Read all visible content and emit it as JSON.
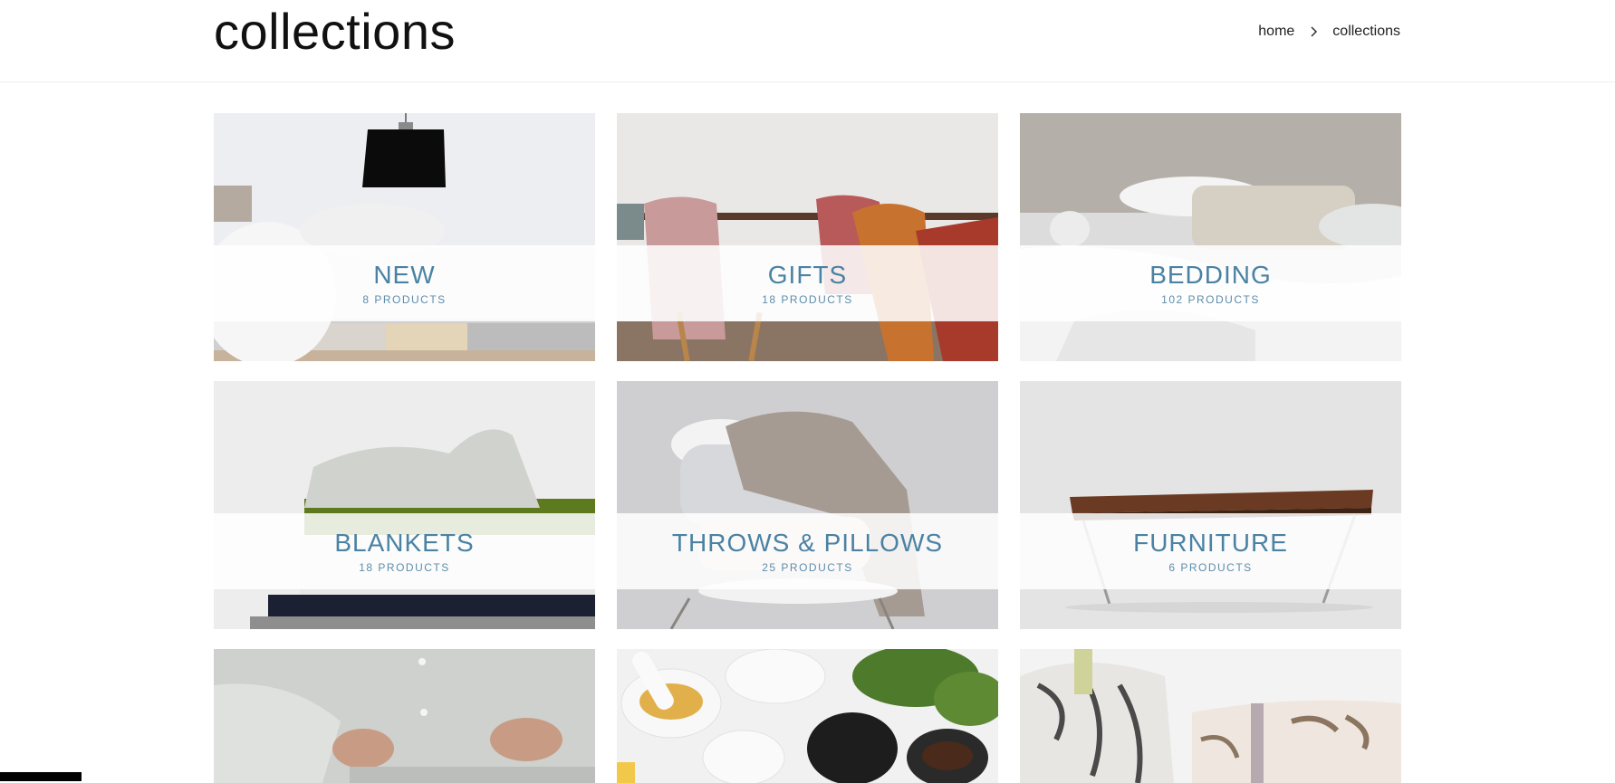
{
  "header": {
    "title": "collections",
    "breadcrumb": [
      {
        "label": "home"
      },
      {
        "label": "collections"
      }
    ]
  },
  "collections": [
    {
      "title": "NEW",
      "count": "8 PRODUCTS"
    },
    {
      "title": "GIFTS",
      "count": "18 PRODUCTS"
    },
    {
      "title": "BEDDING",
      "count": "102 PRODUCTS"
    },
    {
      "title": "BLANKETS",
      "count": "18 PRODUCTS"
    },
    {
      "title": "THROWS & PILLOWS",
      "count": "25 PRODUCTS"
    },
    {
      "title": "FURNITURE",
      "count": "6 PRODUCTS"
    }
  ],
  "colors": {
    "accent_text": "#4a82a3",
    "overlay": "rgba(255,255,255,0.86)"
  },
  "icons": {
    "breadcrumb_separator": "chevron-right-icon"
  }
}
